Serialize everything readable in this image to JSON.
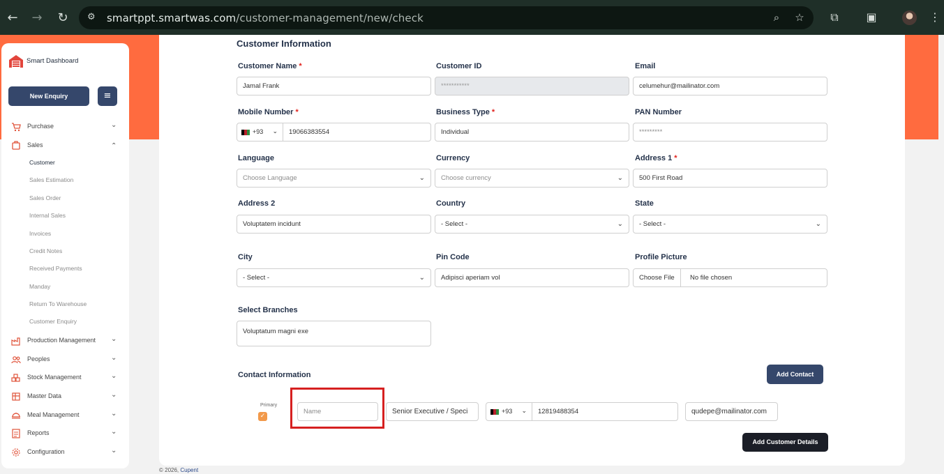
{
  "browser": {
    "url_host": "smartppt.smartwas.com",
    "url_path": "/customer-management/new/check"
  },
  "sidebar": {
    "brand": "Smart Dashboard",
    "new_enquiry": "New Enquiry",
    "items": [
      {
        "label": "Purchase"
      },
      {
        "label": "Sales"
      },
      {
        "label": "Production Management"
      },
      {
        "label": "Peoples"
      },
      {
        "label": "Stock Management"
      },
      {
        "label": "Master Data"
      },
      {
        "label": "Meal Management"
      },
      {
        "label": "Reports"
      },
      {
        "label": "Configuration"
      }
    ],
    "sales_sub": [
      "Customer",
      "Sales Estimation",
      "Sales Order",
      "Internal Sales",
      "Invoices",
      "Credit Notes",
      "Received Payments",
      "Manday",
      "Return To Warehouse",
      "Customer Enquiry"
    ]
  },
  "form": {
    "title": "Customer Information",
    "customer_name": {
      "label": "Customer Name",
      "value": "Jamal Frank"
    },
    "customer_id": {
      "label": "Customer ID",
      "value": "***********"
    },
    "email": {
      "label": "Email",
      "value": "celumehur@mailinator.com"
    },
    "mobile": {
      "label": "Mobile Number",
      "code": "+93",
      "value": "19066383554"
    },
    "business_type": {
      "label": "Business Type",
      "value": "Individual"
    },
    "pan": {
      "label": "PAN Number",
      "value": "*********"
    },
    "language": {
      "label": "Language",
      "value": "Choose Language"
    },
    "currency": {
      "label": "Currency",
      "value": "Choose currency"
    },
    "address1": {
      "label": "Address 1",
      "value": "500 First Road"
    },
    "address2": {
      "label": "Address 2",
      "value": "Voluptatem incidunt"
    },
    "country": {
      "label": "Country",
      "value": "- Select -"
    },
    "state": {
      "label": "State",
      "value": "- Select -"
    },
    "city": {
      "label": "City",
      "value": "- Select -"
    },
    "pincode": {
      "label": "Pin Code",
      "value": "Adipisci aperiam vol"
    },
    "profile": {
      "label": "Profile Picture",
      "button": "Choose File",
      "status": "No file chosen"
    },
    "branches": {
      "label": "Select Branches",
      "value": "Voluptatum magni exe"
    },
    "required_mark": "*"
  },
  "contact": {
    "title": "Contact Information",
    "add_contact": "Add Contact",
    "primary_label": "Primary",
    "name_placeholder": "Name",
    "designation": "Senior Executive / Speci",
    "code": "+93",
    "phone": "12819488354",
    "email": "qudepe@mailinator.com",
    "add_details": "Add Customer Details"
  },
  "footer": {
    "text": "© 2026,",
    "brand": "Cupent"
  },
  "colors": {
    "accent": "#ff6b3f",
    "navy": "#35476b",
    "highlight": "#d62020"
  }
}
